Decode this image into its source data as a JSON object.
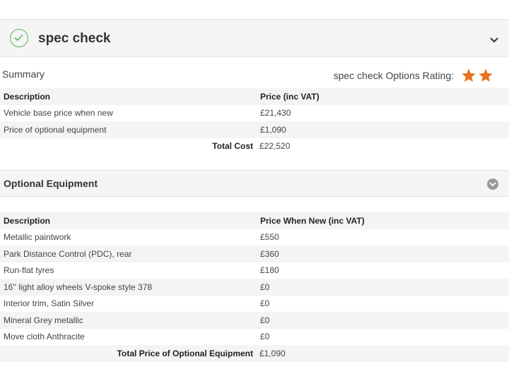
{
  "header": {
    "title": "spec check"
  },
  "summary": {
    "label": "Summary",
    "rating_label": "spec check Options Rating:",
    "rating_stars": 2,
    "columns": [
      "Description",
      "Price (inc VAT)"
    ],
    "rows": [
      {
        "description": "Vehicle base price when new",
        "price": "£21,430"
      },
      {
        "description": "Price of optional equipment",
        "price": "£1,090"
      }
    ],
    "total_label": "Total Cost",
    "total_value": "£22,520"
  },
  "optional": {
    "title": "Optional Equipment",
    "columns": [
      "Description",
      "Price When New (inc VAT)"
    ],
    "rows": [
      {
        "description": "Metallic paintwork",
        "price": "£550"
      },
      {
        "description": "Park Distance Control (PDC), rear",
        "price": "£360"
      },
      {
        "description": "Run-flat tyres",
        "price": "£180"
      },
      {
        "description": "16'' light alloy wheels V-spoke style 378",
        "price": "£0"
      },
      {
        "description": "Interior trim, Satin Silver",
        "price": "£0"
      },
      {
        "description": "Mineral Grey metallic",
        "price": "£0"
      },
      {
        "description": "Move cloth Anthracite",
        "price": "£0"
      }
    ],
    "total_label": "Total Price of Optional Equipment",
    "total_value": "£1,090"
  },
  "colors": {
    "check": "#5cb85c",
    "star": "#e8731a",
    "toggle": "#999999"
  }
}
